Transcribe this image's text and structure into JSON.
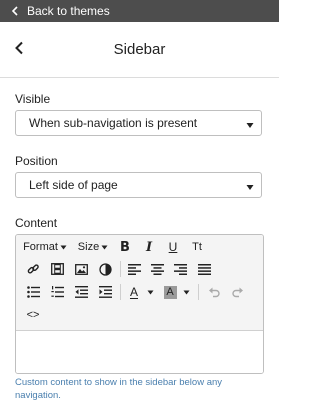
{
  "topbar": {
    "back_label": "Back to themes",
    "back_icon": "chevron-left-icon"
  },
  "header": {
    "title": "Sidebar",
    "back_icon": "chevron-left-icon"
  },
  "fields": {
    "visible": {
      "label": "Visible",
      "value": "When sub-navigation is present"
    },
    "position": {
      "label": "Position",
      "value": "Left side of page"
    },
    "content": {
      "label": "Content",
      "help": "Custom content to show in the sidebar below any navigation."
    }
  },
  "toolbar": {
    "format_label": "Format",
    "size_label": "Size",
    "bold_label": "B",
    "italic_label": "I",
    "underline_label": "U",
    "typeface_label": "Tt",
    "text_color_label": "A",
    "bg_color_label": "A",
    "source_label": "<>"
  },
  "colors": {
    "topbar": "#4d4d4d",
    "help_text": "#4a7fae",
    "toolbar_bg": "#f4f4f4",
    "border": "#bfbfbf"
  }
}
